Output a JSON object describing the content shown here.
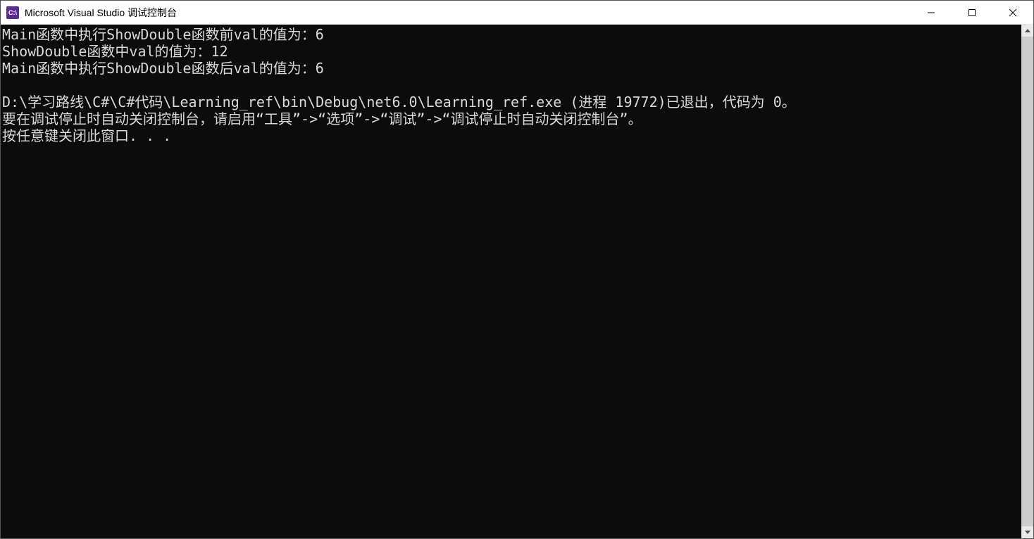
{
  "titlebar": {
    "icon_label": "C:\\",
    "title": "Microsoft Visual Studio 调试控制台"
  },
  "console": {
    "lines": [
      "Main函数中执行ShowDouble函数前val的值为：6",
      "ShowDouble函数中val的值为：12",
      "Main函数中执行ShowDouble函数后val的值为：6",
      "",
      "D:\\学习路线\\C#\\C#代码\\Learning_ref\\bin\\Debug\\net6.0\\Learning_ref.exe (进程 19772)已退出，代码为 0。",
      "要在调试停止时自动关闭控制台，请启用“工具”->“选项”->“调试”->“调试停止时自动关闭控制台”。",
      "按任意键关闭此窗口. . ."
    ]
  }
}
